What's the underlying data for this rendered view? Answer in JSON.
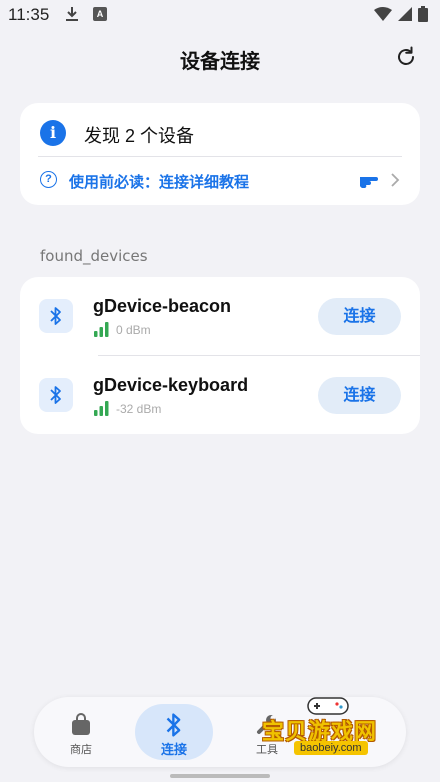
{
  "status_bar": {
    "time": "11:35",
    "icons": [
      "download-icon",
      "app-notification-icon",
      "wifi-icon",
      "signal-icon",
      "battery-icon"
    ],
    "notification_letter": "A"
  },
  "header": {
    "title": "设备连接",
    "refresh_icon": "refresh-icon"
  },
  "info_card": {
    "message": "发现 2 个设备",
    "tutorial_link": "使用前必读：连接详细教程",
    "accent": "#1a73e8"
  },
  "devices_section": {
    "label": "found_devices",
    "devices": [
      {
        "name": "gDevice-beacon",
        "rssi": "0 dBm",
        "action": "连接",
        "signal_color": "#34a853"
      },
      {
        "name": "gDevice-keyboard",
        "rssi": "-32 dBm",
        "action": "连接",
        "signal_color": "#34a853"
      }
    ]
  },
  "bottom_nav": {
    "items": [
      {
        "label": "商店",
        "icon": "shopping-bag-icon",
        "active": false
      },
      {
        "label": "连接",
        "icon": "bluetooth-icon",
        "active": true
      },
      {
        "label": "工具",
        "icon": "wrench-icon",
        "active": false
      }
    ]
  },
  "watermark": {
    "text": "宝贝游戏网",
    "url": "baobeiy.com"
  }
}
